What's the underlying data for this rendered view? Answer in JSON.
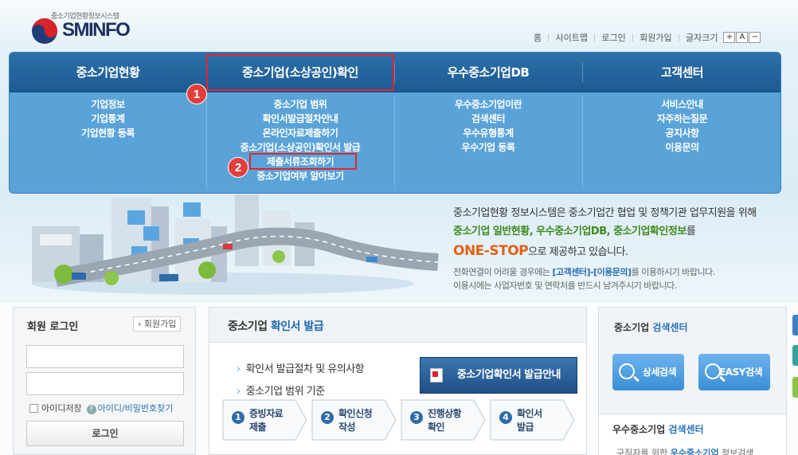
{
  "header": {
    "logo_sub": "중소기업현황정보시스템",
    "logo_text": "SMINFO",
    "topnav": [
      "홈",
      "사이트맵",
      "로그인",
      "회원가입"
    ],
    "font_size_label": "글자크기",
    "font_buttons": [
      "+",
      "A",
      "−"
    ]
  },
  "nav": {
    "menus": [
      {
        "title": "중소기업현황",
        "items": [
          "기업정보",
          "기업통계",
          "기업현황 등록"
        ]
      },
      {
        "title": "중소기업(소상공인)확인",
        "items": [
          "중소기업 범위",
          "확인서발급절차안내",
          "온라인자료제출하기",
          "중소기업(소상공인)확인서 발급",
          "제출서류조회하기",
          "중소기업여부 알아보기"
        ]
      },
      {
        "title": "우수중소기업DB",
        "items": [
          "우수중소기업이란",
          "검색센터",
          "우수유형통계",
          "우수기업 등록"
        ]
      },
      {
        "title": "고객센터",
        "items": [
          "서비스안내",
          "자주하는질문",
          "공지사항",
          "이용문의"
        ]
      }
    ],
    "annotations": [
      "1",
      "2"
    ],
    "highlight_color": "#e0252e"
  },
  "hero": {
    "line1": "중소기업현황 정보시스템은 중소기업간 협업 및 정책기관 업무지원을 위해",
    "line2_green": "중소기업 일반현황, 우수중소기업DB, 중소기업확인정보",
    "line2_rest": "를",
    "onestop": "ONE-STOP",
    "line3_rest": "으로 제공하고 있습니다.",
    "note1_pre": "전화연결이 어려울 경우에는 ",
    "note1_link": "[고객센터]-[이용문의]",
    "note1_post": "를 이용하시기 바랍니다.",
    "note2": "이용시에는 사업자번호 및 연락처를 반드시 남겨주시기 바랍니다."
  },
  "login": {
    "title": "회원 로그인",
    "join": "회원가입",
    "id_value": "",
    "pw_value": "",
    "save_id": "아이디저장",
    "find": "아이디/비밀번호찾기",
    "login_btn": "로그인"
  },
  "issue": {
    "title_pre": "중소기업 ",
    "title_hl": "확인서 발급",
    "bullets": [
      "확인서 발급절차 및 유의사항",
      "중소기업 범위 기준"
    ],
    "guide_btn": "중소기업확인서 발급안내",
    "steps": [
      {
        "num": "1",
        "line1": "증빙자료",
        "line2": "제출"
      },
      {
        "num": "2",
        "line1": "확인신청",
        "line2": "작성"
      },
      {
        "num": "3",
        "line1": "진행상황",
        "line2": "확인"
      },
      {
        "num": "4",
        "line1": "확인서",
        "line2": "발급"
      }
    ]
  },
  "search": {
    "title_pre": "중소기업 ",
    "title_hl": "검색센터",
    "buttons": [
      "상세검색",
      "EASY검색"
    ]
  },
  "search2": {
    "title_pre": "우수중소기업 ",
    "title_hl": "검색센터",
    "sub_pre": "구직자를 위한 ",
    "sub_hl": "우수중소기업",
    "sub_post": " 정보검색"
  }
}
